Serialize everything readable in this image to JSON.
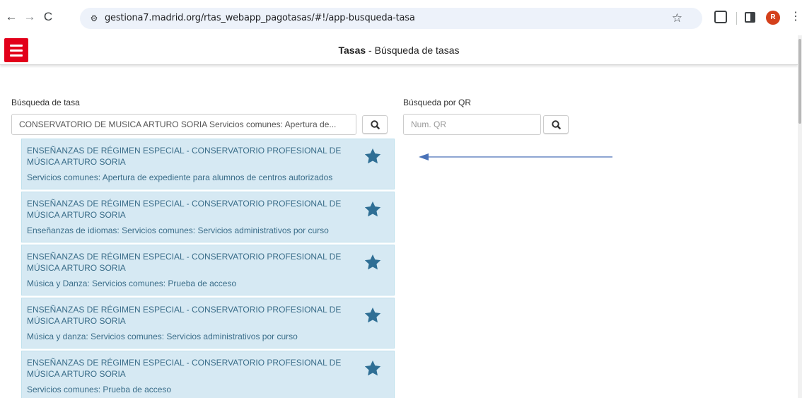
{
  "browser": {
    "url": "gestiona7.madrid.org/rtas_webapp_pagotasas/#!/app-busqueda-tasa",
    "avatar_letter": "R",
    "back_glyph": "←",
    "forward_glyph": "→",
    "reload_glyph": "C",
    "site_info_glyph": "⚙",
    "star_glyph": "☆",
    "menu_glyph": "⋮"
  },
  "header": {
    "title_bold": "Tasas",
    "title_rest": " - Búsqueda de tasas",
    "brand_color": "#e2001a"
  },
  "search": {
    "tasa_label": "Búsqueda de tasa",
    "tasa_value": "CONSERVATORIO DE MUSICA ARTURO SORIA Servicios comunes: Apertura de...",
    "qr_label": "Búsqueda por QR",
    "qr_placeholder": "Num. QR"
  },
  "results": [
    {
      "title": "ENSEÑANZAS DE RÉGIMEN ESPECIAL - CONSERVATORIO PROFESIONAL DE MÚSICA ARTURO SORIA",
      "description": "Servicios comunes: Apertura de expediente para alumnos de centros autorizados"
    },
    {
      "title": "ENSEÑANZAS DE RÉGIMEN ESPECIAL - CONSERVATORIO PROFESIONAL DE MÚSICA ARTURO SORIA",
      "description": "Enseñanzas de idiomas: Servicios comunes: Servicios administrativos por curso"
    },
    {
      "title": "ENSEÑANZAS DE RÉGIMEN ESPECIAL - CONSERVATORIO PROFESIONAL DE MÚSICA ARTURO SORIA",
      "description": "Música y Danza: Servicios comunes: Prueba de acceso"
    },
    {
      "title": "ENSEÑANZAS DE RÉGIMEN ESPECIAL - CONSERVATORIO PROFESIONAL DE MÚSICA ARTURO SORIA",
      "description": "Música y danza: Servicios comunes: Servicios administrativos por curso"
    },
    {
      "title": "ENSEÑANZAS DE RÉGIMEN ESPECIAL - CONSERVATORIO PROFESIONAL DE MÚSICA ARTURO SORIA",
      "description": "Servicios comunes: Prueba de acceso"
    }
  ],
  "colors": {
    "result_bg": "#d6e9f3",
    "result_text": "#3a6d89",
    "star": "#2f6f95",
    "annotation_arrow": "#4a72b8"
  },
  "icons": {
    "favorite": "star-icon",
    "search": "magnifier-icon",
    "menu": "hamburger-icon"
  }
}
